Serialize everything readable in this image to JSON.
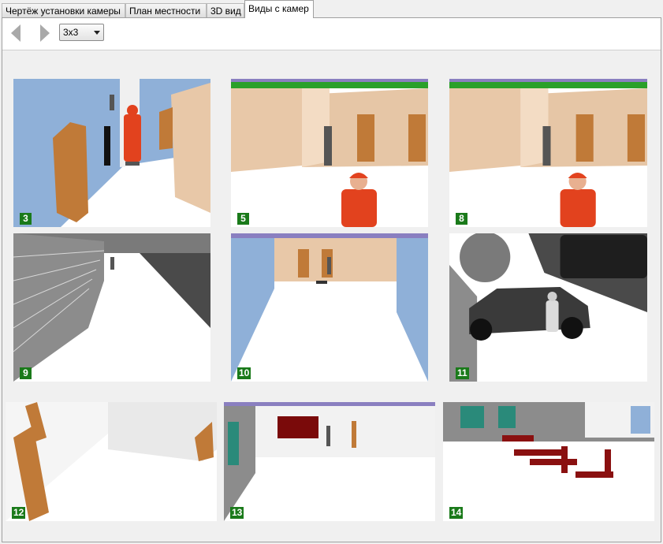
{
  "tabs": [
    {
      "label": "Чертёж установки камеры"
    },
    {
      "label": "План местности"
    },
    {
      "label": "3D вид"
    },
    {
      "label": "Виды с камер"
    }
  ],
  "active_tab": "Виды с камер",
  "toolbar": {
    "prev_icon": "arrow-left-icon",
    "next_icon": "arrow-right-icon",
    "layout_select": {
      "value": "3x3"
    }
  },
  "cameras": [
    {
      "number": "3"
    },
    {
      "number": "5"
    },
    {
      "number": "8"
    },
    {
      "number": "9"
    },
    {
      "number": "10"
    },
    {
      "number": "11"
    },
    {
      "number": "12"
    },
    {
      "number": "13"
    },
    {
      "number": "14"
    }
  ],
  "colors": {
    "camera_label_bg": "#1a7a1a",
    "wall_beige": "#e8c8a8",
    "wall_blue": "#8fb0d8",
    "door_wood": "#c07a38",
    "person_red": "#e2421e",
    "bench_red": "#8a1010"
  }
}
